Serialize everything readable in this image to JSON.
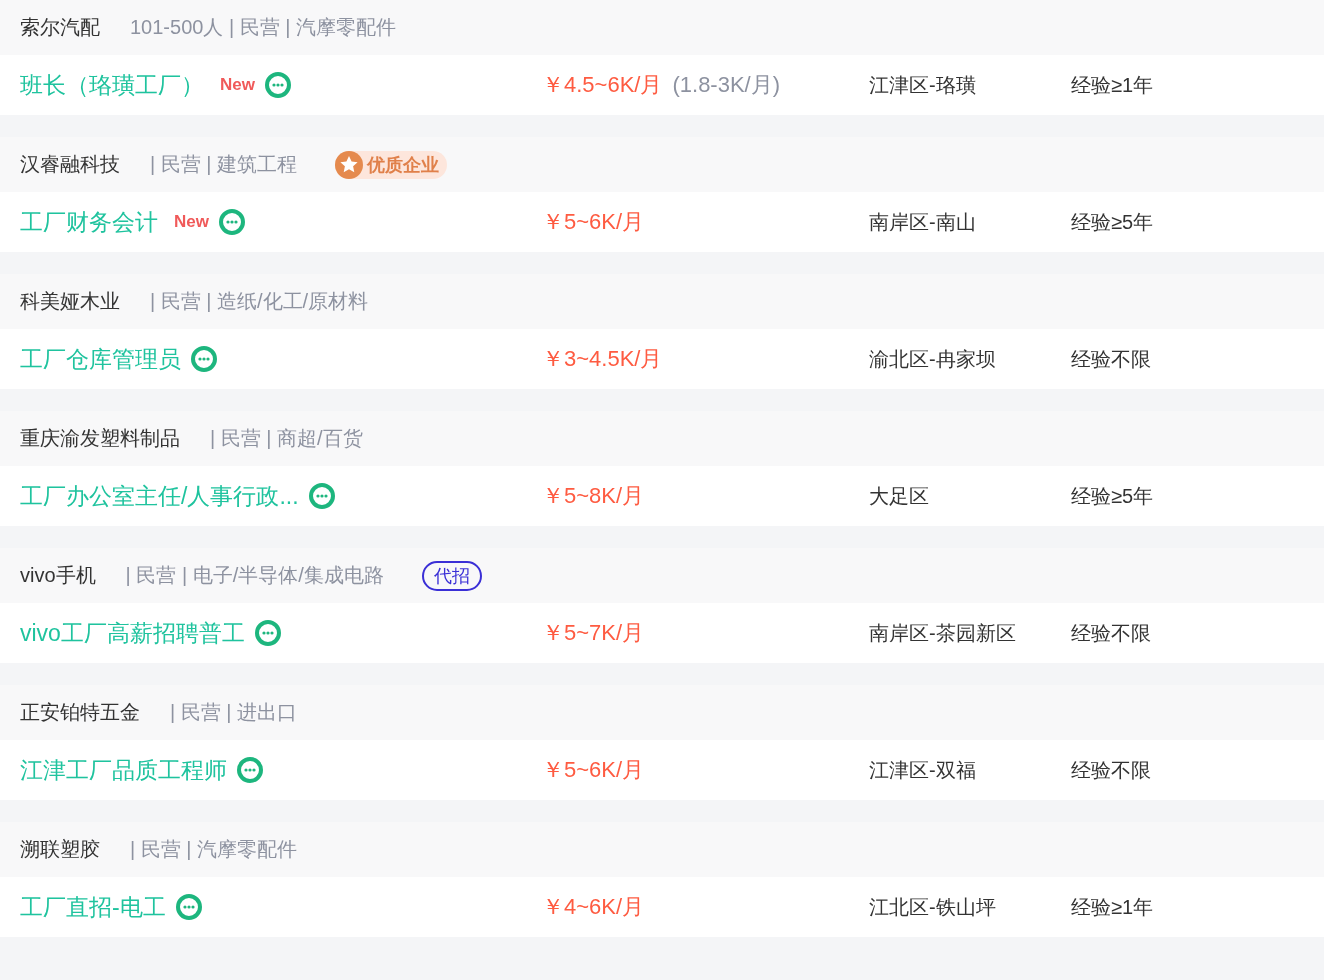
{
  "listings": [
    {
      "company": {
        "name": "索尔汽配",
        "meta": "101-500人 | 民营 | 汽摩零配件"
      },
      "job": {
        "title": "班长（珞璜工厂）",
        "tag": "New",
        "salary": "￥4.5~6K/月",
        "salary_extra": "(1.8-3K/月)",
        "location": "江津区-珞璜",
        "experience": "经验≥1年"
      }
    },
    {
      "company": {
        "name": "汉睿融科技",
        "meta": "| 民营 | 建筑工程",
        "badge": {
          "kind": "quality",
          "label": "优质企业"
        }
      },
      "job": {
        "title": "工厂财务会计",
        "tag": "New",
        "salary": "￥5~6K/月",
        "location": "南岸区-南山",
        "experience": "经验≥5年"
      }
    },
    {
      "company": {
        "name": "科美娅木业",
        "meta": "| 民营 | 造纸/化工/原材料"
      },
      "job": {
        "title": "工厂仓库管理员",
        "salary": "￥3~4.5K/月",
        "location": "渝北区-冉家坝",
        "experience": "经验不限"
      }
    },
    {
      "company": {
        "name": "重庆渝发塑料制品",
        "meta": "| 民营 | 商超/百货"
      },
      "job": {
        "title": "工厂办公室主任/人事行政...",
        "salary": "￥5~8K/月",
        "location": "大足区",
        "experience": "经验≥5年"
      }
    },
    {
      "company": {
        "name": "vivo手机",
        "meta": "| 民营 | 电子/半导体/集成电路",
        "badge": {
          "kind": "agency",
          "label": "代招"
        }
      },
      "job": {
        "title": "vivo工厂高薪招聘普工",
        "salary": "￥5~7K/月",
        "location": "南岸区-茶园新区",
        "experience": "经验不限"
      }
    },
    {
      "company": {
        "name": "正安铂特五金",
        "meta": "| 民营 | 进出口"
      },
      "job": {
        "title": "江津工厂品质工程师",
        "salary": "￥5~6K/月",
        "location": "江津区-双福",
        "experience": "经验不限"
      }
    },
    {
      "company": {
        "name": "溯联塑胶",
        "meta": "| 民营 | 汽摩零配件"
      },
      "job": {
        "title": "工厂直招-电工",
        "salary": "￥4~6K/月",
        "location": "江北区-铁山坪",
        "experience": "经验≥1年"
      }
    }
  ]
}
